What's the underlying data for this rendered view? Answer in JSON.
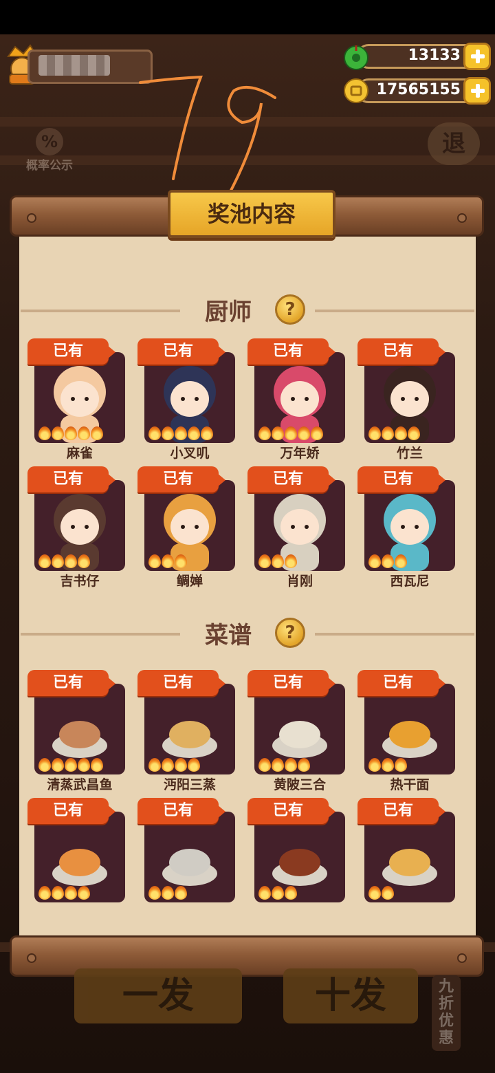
{
  "player": {
    "name_hidden": true
  },
  "currency": {
    "jade": {
      "icon": "jade-coin-icon",
      "value": "13133"
    },
    "coins": {
      "icon": "copper-coin-icon",
      "value": "17565155"
    }
  },
  "probability_label": "概率公示",
  "probability_icon": "%",
  "exit_label": "退",
  "handwriting": "79",
  "panel": {
    "title": "奖池内容",
    "chef_section": {
      "title": "厨师",
      "help": "?",
      "items": [
        {
          "status": "已有",
          "name": "麻雀",
          "stars": 5,
          "color": "#f4c9a0"
        },
        {
          "status": "已有",
          "name": "小叉叽",
          "stars": 5,
          "color": "#2e3457"
        },
        {
          "status": "已有",
          "name": "万年娇",
          "stars": 5,
          "color": "#d94a6a"
        },
        {
          "status": "已有",
          "name": "竹兰",
          "stars": 4,
          "color": "#3a2420"
        },
        {
          "status": "已有",
          "name": "吉书仔",
          "stars": 4,
          "color": "#5a3a30"
        },
        {
          "status": "已有",
          "name": "鲷婵",
          "stars": 3,
          "color": "#e8a040"
        },
        {
          "status": "已有",
          "name": "肖刚",
          "stars": 3,
          "color": "#d8d0c0"
        },
        {
          "status": "已有",
          "name": "西瓦尼",
          "stars": 3,
          "color": "#5ab8c8"
        }
      ]
    },
    "recipe_section": {
      "title": "菜谱",
      "help": "?",
      "items": [
        {
          "status": "已有",
          "name": "清蒸武昌鱼",
          "stars": 5,
          "color": "#c8865a"
        },
        {
          "status": "已有",
          "name": "沔阳三蒸",
          "stars": 4,
          "color": "#e0b060"
        },
        {
          "status": "已有",
          "name": "黄陂三合",
          "stars": 4,
          "color": "#e8e0d0"
        },
        {
          "status": "已有",
          "name": "热干面",
          "stars": 3,
          "color": "#e8a030"
        },
        {
          "status": "已有",
          "name": "",
          "stars": 4,
          "color": "#e89040"
        },
        {
          "status": "已有",
          "name": "",
          "stars": 3,
          "color": "#d0ccc4"
        },
        {
          "status": "已有",
          "name": "",
          "stars": 3,
          "color": "#8a3a20"
        },
        {
          "status": "已有",
          "name": "",
          "stars": 2,
          "color": "#e8b050"
        }
      ]
    }
  },
  "footer": {
    "single": "一发",
    "ten": "十发",
    "discount": "九折优惠"
  }
}
